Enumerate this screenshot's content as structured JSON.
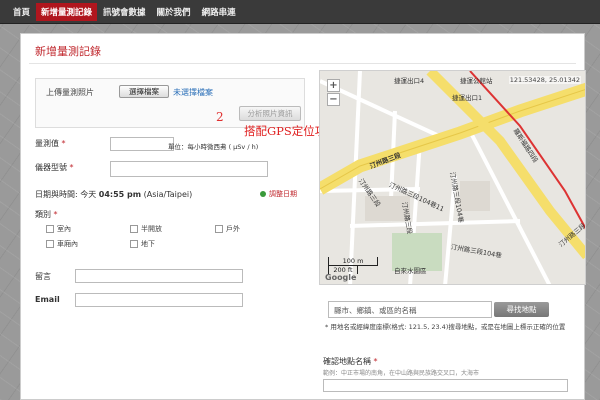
{
  "nav": {
    "items": [
      {
        "label": "首頁",
        "active": false
      },
      {
        "label": "新增量測記錄",
        "active": true
      },
      {
        "label": "訊號會數據",
        "active": false
      },
      {
        "label": "關於我們",
        "active": false
      },
      {
        "label": "網路串連",
        "active": false
      }
    ]
  },
  "page": {
    "title": "新增量測記錄"
  },
  "upload": {
    "label": "上傳量測照片",
    "file_button": "選擇檔案",
    "no_file": "未選擇檔案",
    "analyze_button": "分析照片資訊"
  },
  "annotation": {
    "number": "2",
    "note": "搭配GPS定位功能"
  },
  "form": {
    "measure_label": "量測值",
    "unit_text": "單位：每小時微西弗 ( μSv / h)",
    "device_label": "儀器型號",
    "datetime_prefix": "日期與時間: 今天 ",
    "datetime_time": "04:55 pm",
    "datetime_tz": " (Asia/Taipei)",
    "adjust_date": "調整日期",
    "category_label": "類別",
    "categories": [
      "室內",
      "半開放",
      "戶外",
      "車廂內",
      "地下"
    ],
    "message_label": "留言",
    "email_label": "Email",
    "required_mark": "*"
  },
  "map": {
    "coords": "121.53428, 25.01342",
    "zoom_in": "+",
    "zoom_out": "−",
    "labels": {
      "station1": "捷運出口4",
      "station2": "捷運公館站",
      "road_main": "汀州路三段",
      "road_side": "羅斯福路四段",
      "lane1": "汀州路三段104巷11",
      "lane2": "汀州路三段104巷",
      "lane3": "汀州路三段104巷",
      "lane4": "汀州路三段",
      "lane5": "汀州路三段",
      "park": "自來水園區",
      "station3": "捷運出口1",
      "road_right": "汀州路三段"
    },
    "scale_m": "100 m",
    "scale_ft": "200 ft",
    "logo": "Google"
  },
  "search": {
    "placeholder": "縣市、鄉鎮、或區的名稱",
    "button": "尋找地點",
    "hint": "* 用地名或經緯度座標(格式: 121.5, 23.4)搜尋地點，或是在地圖上標示正確的位置"
  },
  "confirm": {
    "label": "確認地點名稱",
    "example": "範例：中正市場的南角，在中山路與民族路交叉口，大海市"
  },
  "colors": {
    "brand_red": "#c0272d",
    "nav_bg": "#3a3a3a",
    "note_red": "#e02020"
  }
}
